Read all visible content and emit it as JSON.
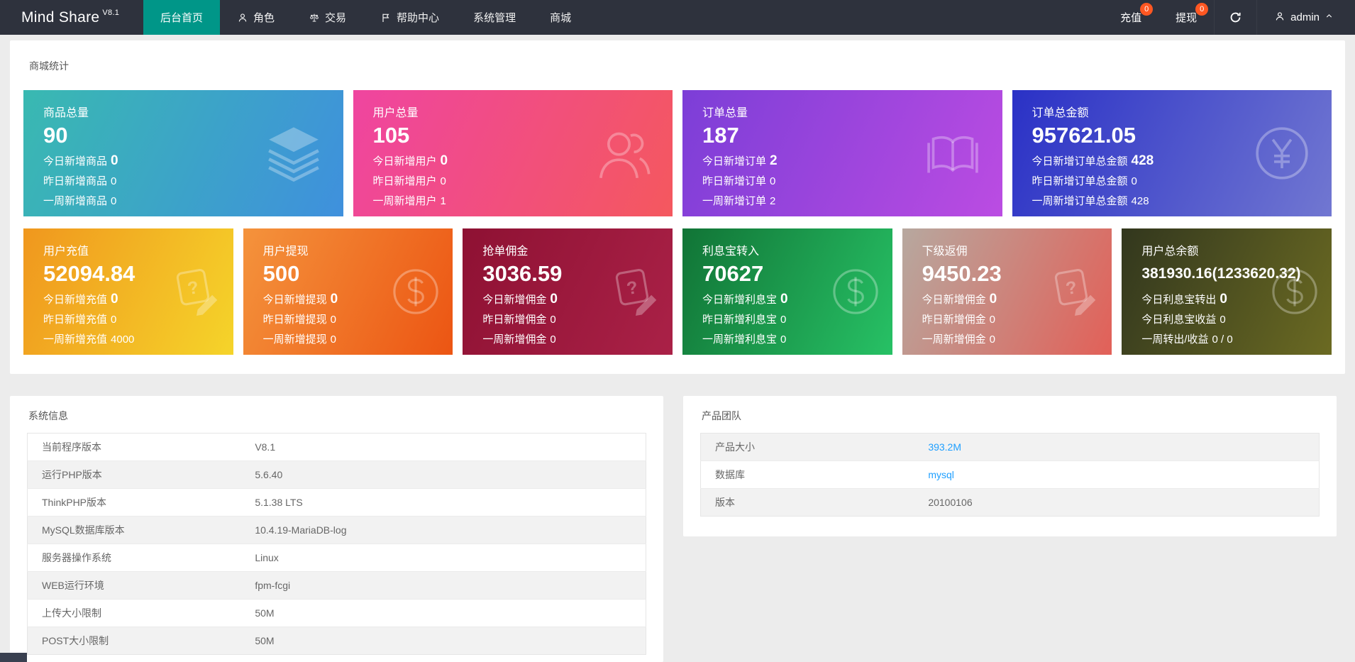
{
  "colors": {
    "nav_bg": "#2e323d",
    "accent_teal": "#009688",
    "badge_orange": "#ff5722",
    "link_blue": "#1e9fff"
  },
  "navbar": {
    "logo": "Mind Share",
    "logo_version": "V8.1",
    "menu": [
      {
        "id": "home",
        "label": "后台首页",
        "icon": null,
        "active": true
      },
      {
        "id": "roles",
        "label": "角色",
        "icon": "person-icon",
        "active": false
      },
      {
        "id": "trade",
        "label": "交易",
        "icon": "scales-icon",
        "active": false
      },
      {
        "id": "help-center",
        "label": "帮助中心",
        "icon": "flag-icon",
        "active": false
      },
      {
        "id": "system",
        "label": "系统管理",
        "icon": null,
        "active": false
      },
      {
        "id": "mall",
        "label": "商城",
        "icon": null,
        "active": false
      }
    ],
    "actions": [
      {
        "id": "recharge",
        "label": "充值",
        "badge": "0"
      },
      {
        "id": "withdraw",
        "label": "提现",
        "badge": "0"
      }
    ],
    "refresh_icon": "refresh-icon",
    "user": {
      "name": "admin",
      "icon": "user-icon",
      "chevron": "chevron-up-icon"
    }
  },
  "stats_panel": {
    "title": "商城统计",
    "row1": [
      {
        "id": "products-total",
        "label": "商品总量",
        "value": "90",
        "icon": "layers-icon",
        "gradient": [
          "#39b9b1",
          "#3f90dd"
        ],
        "lines": [
          {
            "text": "今日新增商品",
            "value": "0",
            "bold": true
          },
          {
            "text": "昨日新增商品",
            "value": "0",
            "bold": false
          },
          {
            "text": "一周新增商品",
            "value": "0",
            "bold": false
          }
        ]
      },
      {
        "id": "users-total",
        "label": "用户总量",
        "value": "105",
        "icon": "users-icon",
        "gradient": [
          "#ef45a0",
          "#f4585e"
        ],
        "lines": [
          {
            "text": "今日新增用户",
            "value": "0",
            "bold": true
          },
          {
            "text": "昨日新增用户",
            "value": "0",
            "bold": false
          },
          {
            "text": "一周新增用户",
            "value": "1",
            "bold": false
          }
        ]
      },
      {
        "id": "orders-total",
        "label": "订单总量",
        "value": "187",
        "icon": "book-icon",
        "gradient": [
          "#7c3ed7",
          "#bb4ce2"
        ],
        "lines": [
          {
            "text": "今日新增订单",
            "value": "2",
            "bold": true
          },
          {
            "text": "昨日新增订单",
            "value": "0",
            "bold": false
          },
          {
            "text": "一周新增订单",
            "value": "2",
            "bold": false
          }
        ]
      },
      {
        "id": "orders-amount",
        "label": "订单总金额",
        "value": "957621.05",
        "icon": "yen-icon",
        "gradient": [
          "#2a31c6",
          "#7177d1"
        ],
        "lines": [
          {
            "text": "今日新增订单总金额",
            "value": "428",
            "bold": true
          },
          {
            "text": "昨日新增订单总金额",
            "value": "0",
            "bold": false
          },
          {
            "text": "一周新增订单总金额",
            "value": "428",
            "bold": false
          }
        ]
      }
    ],
    "row2": [
      {
        "id": "user-recharge",
        "label": "用户充值",
        "value": "52094.84",
        "icon": "note-edit-icon",
        "gradient": [
          "#f0971e",
          "#f5d42a"
        ],
        "lines": [
          {
            "text": "今日新增充值",
            "value": "0",
            "bold": true
          },
          {
            "text": "昨日新增充值",
            "value": "0",
            "bold": false
          },
          {
            "text": "一周新增充值",
            "value": "4000",
            "bold": false
          }
        ]
      },
      {
        "id": "user-withdraw",
        "label": "用户提现",
        "value": "500",
        "icon": "dollar-icon",
        "gradient": [
          "#f4933c",
          "#ec5513"
        ],
        "lines": [
          {
            "text": "今日新增提现",
            "value": "0",
            "bold": true
          },
          {
            "text": "昨日新增提现",
            "value": "0",
            "bold": false
          },
          {
            "text": "一周新增提现",
            "value": "0",
            "bold": false
          }
        ]
      },
      {
        "id": "order-commission",
        "label": "抢单佣金",
        "value": "3036.59",
        "icon": "note-edit-icon",
        "gradient": [
          "#8e1133",
          "#aa2147"
        ],
        "lines": [
          {
            "text": "今日新增佣金",
            "value": "0",
            "bold": true
          },
          {
            "text": "昨日新增佣金",
            "value": "0",
            "bold": false
          },
          {
            "text": "一周新增佣金",
            "value": "0",
            "bold": false
          }
        ]
      },
      {
        "id": "interest-in",
        "label": "利息宝转入",
        "value": "70627",
        "icon": "dollar-icon",
        "gradient": [
          "#117436",
          "#27c165"
        ],
        "lines": [
          {
            "text": "今日新增利息宝",
            "value": "0",
            "bold": true
          },
          {
            "text": "昨日新增利息宝",
            "value": "0",
            "bold": false
          },
          {
            "text": "一周新增利息宝",
            "value": "0",
            "bold": false
          }
        ]
      },
      {
        "id": "sub-rebate",
        "label": "下级返佣",
        "value": "9450.23",
        "icon": "note-edit-icon",
        "gradient": [
          "#b7a89f",
          "#e26058"
        ],
        "lines": [
          {
            "text": "今日新增佣金",
            "value": "0",
            "bold": true
          },
          {
            "text": "昨日新增佣金",
            "value": "0",
            "bold": false
          },
          {
            "text": "一周新增佣金",
            "value": "0",
            "bold": false
          }
        ]
      },
      {
        "id": "user-balance",
        "label": "用户总余额",
        "value": "381930.16(1233620.32)",
        "value_small": true,
        "icon": "dollar-icon",
        "gradient": [
          "#32371e",
          "#6b6a22"
        ],
        "lines": [
          {
            "text": "今日利息宝转出",
            "value": "0",
            "bold": true
          },
          {
            "text": "今日利息宝收益",
            "value": "0",
            "bold": false
          },
          {
            "text": "一周转出/收益",
            "value": "0 / 0",
            "bold": false
          }
        ]
      }
    ]
  },
  "system_panel": {
    "title": "系统信息",
    "rows": [
      {
        "label": "当前程序版本",
        "value": "V8.1"
      },
      {
        "label": "运行PHP版本",
        "value": "5.6.40"
      },
      {
        "label": "ThinkPHP版本",
        "value": "5.1.38 LTS"
      },
      {
        "label": "MySQL数据库版本",
        "value": "10.4.19-MariaDB-log"
      },
      {
        "label": "服务器操作系统",
        "value": "Linux"
      },
      {
        "label": "WEB运行环境",
        "value": "fpm-fcgi"
      },
      {
        "label": "上传大小限制",
        "value": "50M"
      },
      {
        "label": "POST大小限制",
        "value": "50M"
      }
    ]
  },
  "team_panel": {
    "title": "产品团队",
    "rows": [
      {
        "label": "产品大小",
        "value": "393.2M",
        "link": true
      },
      {
        "label": "数据库",
        "value": "mysql",
        "link": true
      },
      {
        "label": "版本",
        "value": "20100106",
        "link": false
      }
    ]
  }
}
